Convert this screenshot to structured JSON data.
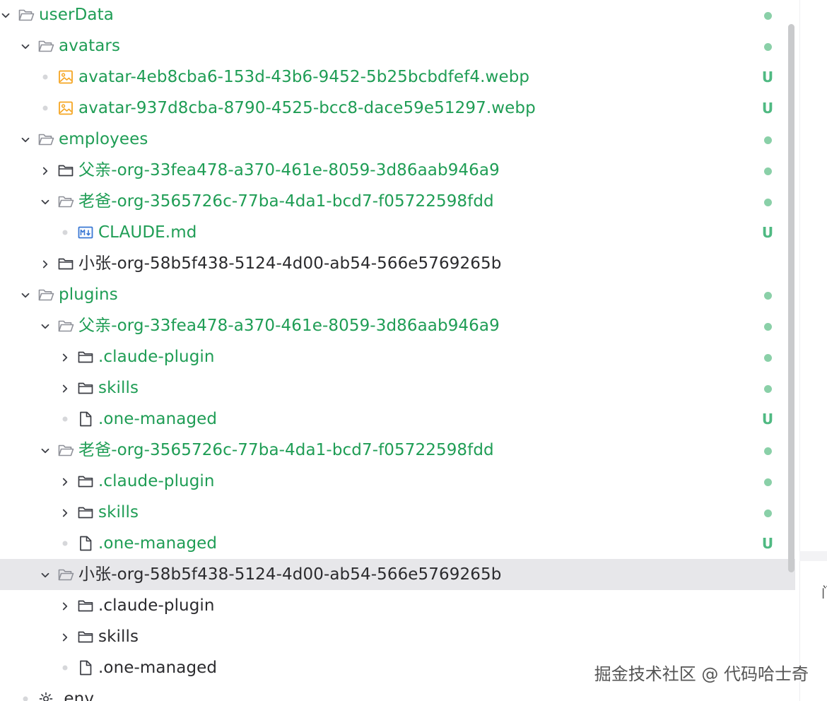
{
  "colors": {
    "modified_text": "#1f9d55",
    "normal_text": "#2b2b2e",
    "status_untracked": "#4fb982",
    "status_dot": "#8ad0a8",
    "selected_row_bg": "#e7e7ea",
    "folder_icon": "#3b3d44",
    "image_icon": "#f5a623",
    "markdown_icon": "#3a78d4"
  },
  "tree": {
    "rows": [
      {
        "label": "userData",
        "kind": "folder",
        "icon": "folder-open-icon",
        "depth": 0,
        "expanded": true,
        "git": "modified",
        "status": "dot"
      },
      {
        "label": "avatars",
        "kind": "folder",
        "icon": "folder-open-icon",
        "depth": 1,
        "expanded": true,
        "git": "modified",
        "status": "dot"
      },
      {
        "label": "avatar-4eb8cba6-153d-43b6-9452-5b25bcbdfef4.webp",
        "kind": "file",
        "icon": "image-file-icon",
        "depth": 2,
        "git": "untracked",
        "status": "U"
      },
      {
        "label": "avatar-937d8cba-8790-4525-bcc8-dace59e51297.webp",
        "kind": "file",
        "icon": "image-file-icon",
        "depth": 2,
        "git": "untracked",
        "status": "U"
      },
      {
        "label": "employees",
        "kind": "folder",
        "icon": "folder-open-icon",
        "depth": 1,
        "expanded": true,
        "git": "modified",
        "status": "dot"
      },
      {
        "label": "父亲-org-33fea478-a370-461e-8059-3d86aab946a9",
        "kind": "folder",
        "icon": "folder-closed-icon",
        "depth": 2,
        "expanded": false,
        "git": "modified",
        "status": "dot"
      },
      {
        "label": "老爸-org-3565726c-77ba-4da1-bcd7-f05722598fdd",
        "kind": "folder",
        "icon": "folder-open-icon",
        "depth": 2,
        "expanded": true,
        "git": "modified",
        "status": "dot"
      },
      {
        "label": "CLAUDE.md",
        "kind": "file",
        "icon": "markdown-file-icon",
        "depth": 3,
        "git": "untracked",
        "status": "U"
      },
      {
        "label": "小张-org-58b5f438-5124-4d00-ab54-566e5769265b",
        "kind": "folder",
        "icon": "folder-closed-icon",
        "depth": 2,
        "expanded": false,
        "git": "none",
        "status": ""
      },
      {
        "label": "plugins",
        "kind": "folder",
        "icon": "folder-open-icon",
        "depth": 1,
        "expanded": true,
        "git": "modified",
        "status": "dot"
      },
      {
        "label": "父亲-org-33fea478-a370-461e-8059-3d86aab946a9",
        "kind": "folder",
        "icon": "folder-open-icon",
        "depth": 2,
        "expanded": true,
        "git": "modified",
        "status": "dot"
      },
      {
        "label": ".claude-plugin",
        "kind": "folder",
        "icon": "folder-closed-icon",
        "depth": 3,
        "expanded": false,
        "git": "modified",
        "status": "dot"
      },
      {
        "label": "skills",
        "kind": "folder",
        "icon": "folder-closed-icon",
        "depth": 3,
        "expanded": false,
        "git": "modified",
        "status": "dot"
      },
      {
        "label": ".one-managed",
        "kind": "file",
        "icon": "file-icon",
        "depth": 3,
        "git": "untracked",
        "status": "U"
      },
      {
        "label": "老爸-org-3565726c-77ba-4da1-bcd7-f05722598fdd",
        "kind": "folder",
        "icon": "folder-open-icon",
        "depth": 2,
        "expanded": true,
        "git": "modified",
        "status": "dot"
      },
      {
        "label": ".claude-plugin",
        "kind": "folder",
        "icon": "folder-closed-icon",
        "depth": 3,
        "expanded": false,
        "git": "modified",
        "status": "dot"
      },
      {
        "label": "skills",
        "kind": "folder",
        "icon": "folder-closed-icon",
        "depth": 3,
        "expanded": false,
        "git": "modified",
        "status": "dot"
      },
      {
        "label": ".one-managed",
        "kind": "file",
        "icon": "file-icon",
        "depth": 3,
        "git": "untracked",
        "status": "U"
      },
      {
        "label": "小张-org-58b5f438-5124-4d00-ab54-566e5769265b",
        "kind": "folder",
        "icon": "folder-open-icon",
        "depth": 2,
        "expanded": true,
        "git": "none",
        "status": "",
        "selected": true
      },
      {
        "label": ".claude-plugin",
        "kind": "folder",
        "icon": "folder-closed-icon",
        "depth": 3,
        "expanded": false,
        "git": "none",
        "status": ""
      },
      {
        "label": "skills",
        "kind": "folder",
        "icon": "folder-closed-icon",
        "depth": 3,
        "expanded": false,
        "git": "none",
        "status": ""
      },
      {
        "label": ".one-managed",
        "kind": "file",
        "icon": "file-icon",
        "depth": 3,
        "git": "none",
        "status": ""
      },
      {
        "label": ".env",
        "kind": "file",
        "icon": "gear-file-icon",
        "depth": 1,
        "git": "none",
        "status": ""
      }
    ]
  },
  "watermark": "掘金技术社区 @ 代码哈士奇",
  "right_panel": {
    "glyph": "门"
  }
}
